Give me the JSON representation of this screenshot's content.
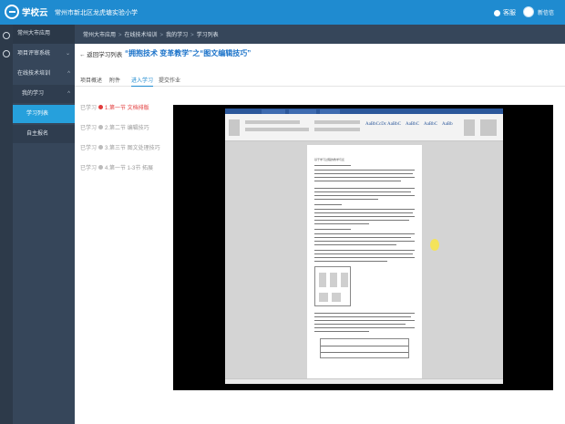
{
  "app": {
    "logo_text": "学校云",
    "school_name": "常州市新北区龙虎塘实验小学",
    "service_label": "客服",
    "user_name": "新信信"
  },
  "sidebar": {
    "header": "常州大市应用",
    "items": [
      {
        "label": "项目评审系统",
        "chevron": "⌄"
      },
      {
        "label": "在线技术培训",
        "chevron": "^"
      },
      {
        "label": "我的学习",
        "chevron": "^"
      },
      {
        "label": "学习列表"
      },
      {
        "label": "自主报名"
      }
    ]
  },
  "breadcrumb": [
    "常州大市应用",
    "在线技术培训",
    "我的学习",
    "学习列表"
  ],
  "page": {
    "back_label": "← 返回学习列表",
    "course_title": "“拥抱技术 变革教学”之“图文编辑技巧”"
  },
  "tabs": [
    "项目概述",
    "附件",
    "进入学习",
    "提交作业"
  ],
  "active_tab": 2,
  "chapters": [
    {
      "status": "已学习",
      "label": "1.第一节 文档排版",
      "current": true
    },
    {
      "status": "已学习",
      "label": "2.第二节 编辑技巧",
      "current": false
    },
    {
      "status": "已学习",
      "label": "3.第三节 图文处理技巧",
      "current": false
    },
    {
      "status": "已学习",
      "label": "4.第一节 1-3节 拓展",
      "current": false
    }
  ],
  "viewer": {
    "ribbon_styles": [
      "AaBbCcDc",
      "AaBbC",
      "AaBbC",
      "AaBbC",
      "AaBb"
    ],
    "doc_title": "基于学习过程的教学与反"
  },
  "colors": {
    "topbar": "#1f8bd0",
    "sidebar": "#36465a",
    "active_item": "#26a0dc",
    "title_blue": "#1a72c9",
    "current_red": "#e23b3b"
  }
}
